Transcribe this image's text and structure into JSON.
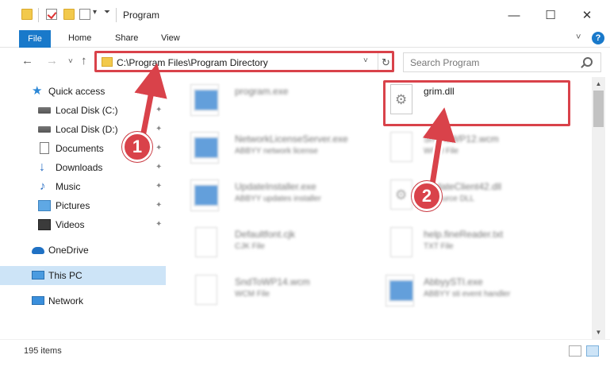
{
  "window": {
    "title": "Program",
    "minimize": "—",
    "maximize": "☐",
    "close": "✕"
  },
  "ribbon": {
    "tabs": [
      "File",
      "Home",
      "Share",
      "View"
    ],
    "expand": "˅",
    "help": "?"
  },
  "nav": {
    "back": "←",
    "forward": "→",
    "recent": "˅",
    "up": "↑",
    "address": "C:\\Program Files\\Program Directory",
    "address_dropdown": "˅",
    "refresh": "↻",
    "search_placeholder": "Search Program"
  },
  "sidebar": {
    "items": [
      {
        "label": "Quick access",
        "icon": "star-icon",
        "pinned": false
      },
      {
        "label": "Local Disk (C:)",
        "icon": "drive-icon",
        "pinned": true
      },
      {
        "label": "Local Disk (D:)",
        "icon": "drive-icon",
        "pinned": true
      },
      {
        "label": "Documents",
        "icon": "documents-icon",
        "pinned": true
      },
      {
        "label": "Downloads",
        "icon": "downloads-icon",
        "pinned": true
      },
      {
        "label": "Music",
        "icon": "music-icon",
        "pinned": true
      },
      {
        "label": "Pictures",
        "icon": "pictures-icon",
        "pinned": true
      },
      {
        "label": "Videos",
        "icon": "videos-icon",
        "pinned": true
      },
      {
        "label": "OneDrive",
        "icon": "onedrive-icon",
        "pinned": false
      },
      {
        "label": "This PC",
        "icon": "this-pc-icon",
        "pinned": false,
        "selected": true
      },
      {
        "label": "Network",
        "icon": "network-icon",
        "pinned": false
      }
    ],
    "pin_glyph": "📌"
  },
  "files": [
    {
      "name": "program.exe",
      "desc": "",
      "icon": "exe-icon",
      "blurred": true
    },
    {
      "name": "grim.dll",
      "desc": "",
      "icon": "dll-icon",
      "blurred": false
    },
    {
      "name": "NetworkLicenseServer.exe",
      "desc": "ABBYY network license",
      "icon": "exe-icon",
      "blurred": true
    },
    {
      "name": "SndToWP12.wcm",
      "desc": "WCM File",
      "icon": "document-icon",
      "blurred": true
    },
    {
      "name": "UpdateInstaller.exe",
      "desc": "ABBYY updates installer",
      "icon": "exe-icon",
      "blurred": true
    },
    {
      "name": "UpdateClient42.dll",
      "desc": "Resource DLL",
      "icon": "dll-icon",
      "blurred": true
    },
    {
      "name": "Defaultfont.cjk",
      "desc": "CJK File",
      "icon": "document-icon",
      "blurred": true
    },
    {
      "name": "help.fineReader.txt",
      "desc": "TXT File",
      "icon": "document-icon",
      "blurred": true
    },
    {
      "name": "SndToWP14.wcm",
      "desc": "WCM File",
      "icon": "document-icon",
      "blurred": true
    },
    {
      "name": "AbbyySTI.exe",
      "desc": "ABBYY sti event handler",
      "icon": "exe-icon",
      "blurred": true
    }
  ],
  "callouts": [
    "1",
    "2"
  ],
  "status": {
    "items_count": "195 items"
  },
  "scrollbar": {
    "up": "▲",
    "down": "▼"
  },
  "colors": {
    "accent": "#1979ca",
    "highlight": "#d9424a",
    "selected": "#cde4f7"
  }
}
